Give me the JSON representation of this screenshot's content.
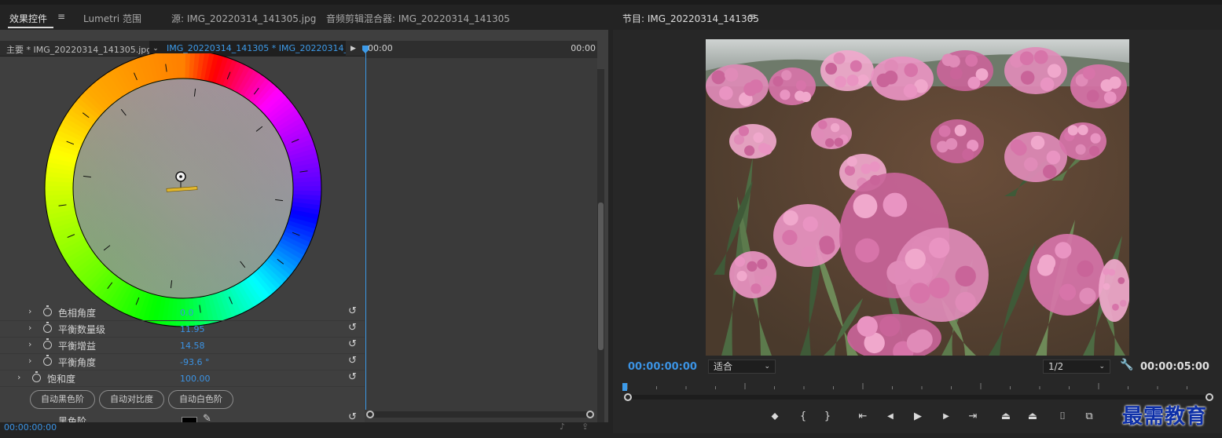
{
  "left_panel": {
    "tabs": [
      {
        "label": "效果控件"
      },
      {
        "label": "Lumetri 范围"
      },
      {
        "label": "源: IMG_20220314_141305.jpg"
      },
      {
        "label": "音频剪辑混合器: IMG_20220314_141305"
      }
    ],
    "menu_glyph": "≡",
    "clip_master": "主要 * IMG_20220314_141305.jpg",
    "clip_seq": "IMG_20220314_141305 * IMG_20220314_...",
    "timeline": {
      "start": "00:00",
      "end": "00:00"
    },
    "properties": [
      {
        "label": "色相角度",
        "value": "0.0",
        "indent": false
      },
      {
        "label": "平衡数量级",
        "value": "11.95",
        "indent": false
      },
      {
        "label": "平衡增益",
        "value": "14.58",
        "indent": false
      },
      {
        "label": "平衡角度",
        "value": "-93.6 °",
        "indent": false
      },
      {
        "label": "饱和度",
        "value": "100.00",
        "indent": true
      }
    ],
    "auto_buttons": [
      "自动黑色阶",
      "自动对比度",
      "自动白色阶"
    ],
    "black_level_label": "黑色阶",
    "timecode": "00:00:00:00",
    "glyphs": {
      "chevron": "›",
      "reset": "↺",
      "eyedropper": "✎",
      "play": "▶",
      "dropdown": "⌄"
    }
  },
  "right_panel": {
    "title": "节目: IMG_20220314_141305",
    "menu_glyph": "≡",
    "timecode_current": "00:00:00:00",
    "timecode_duration": "00:00:05:00",
    "fit_select": "适合",
    "resolution_select": "1/2",
    "transport": [
      {
        "name": "add-marker",
        "glyph": "⬥"
      },
      {
        "name": "mark-in",
        "glyph": "{"
      },
      {
        "name": "mark-out",
        "glyph": "}"
      },
      {
        "name": "go-to-in",
        "glyph": "⇤"
      },
      {
        "name": "step-back",
        "glyph": "◀"
      },
      {
        "name": "play",
        "glyph": "▶"
      },
      {
        "name": "step-forward",
        "glyph": "▶"
      },
      {
        "name": "go-to-out",
        "glyph": "⇥"
      },
      {
        "name": "lift",
        "glyph": "⏏"
      },
      {
        "name": "extract",
        "glyph": "⏏"
      },
      {
        "name": "export-frame",
        "glyph": "⌷"
      },
      {
        "name": "comparison-view",
        "glyph": "⧉"
      }
    ]
  },
  "watermark": "最需教育",
  "colors": {
    "accent_blue": "#3b93e4",
    "panel_bg": "#3f3f3f",
    "app_bg": "#232323"
  }
}
